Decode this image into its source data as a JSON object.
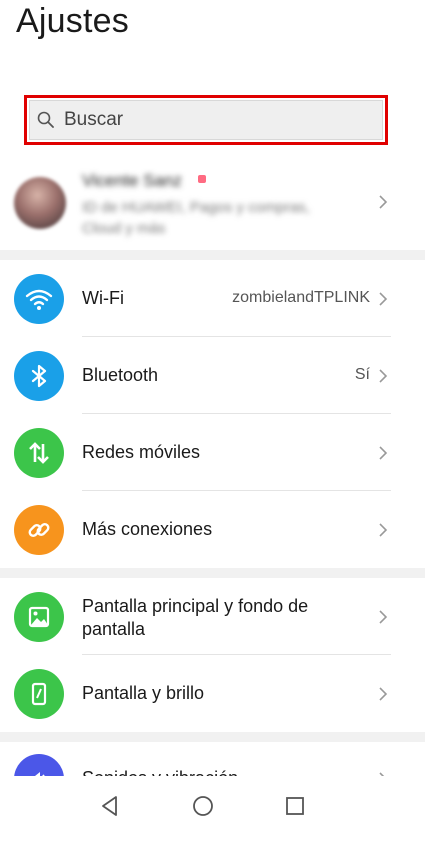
{
  "header": {
    "title": "Ajustes"
  },
  "search": {
    "placeholder": "Buscar"
  },
  "account": {
    "name": "Vicente Sanz",
    "subtitle": "ID de HUAWEI, Pagos y compras, Cloud y más"
  },
  "sections": [
    {
      "items": [
        {
          "label": "Wi-Fi",
          "value": "zombielandTPLINK",
          "icon": "wifi-icon",
          "color": "#1aa0e8"
        },
        {
          "label": "Bluetooth",
          "value": "Sí",
          "icon": "bluetooth-icon",
          "color": "#1aa0e8"
        },
        {
          "label": "Redes móviles",
          "value": "",
          "icon": "mobile-data-icon",
          "color": "#3cc54a"
        },
        {
          "label": "Más conexiones",
          "value": "",
          "icon": "link-icon",
          "color": "#f7941d"
        }
      ]
    },
    {
      "items": [
        {
          "label": "Pantalla principal y fondo de pantalla",
          "icon": "wallpaper-icon",
          "color": "#3cc54a"
        },
        {
          "label": "Pantalla y brillo",
          "icon": "display-brightness-icon",
          "color": "#3cc54a"
        }
      ]
    },
    {
      "items": [
        {
          "label": "Sonidos y vibración",
          "icon": "sound-icon",
          "color": "#4b57e8"
        }
      ]
    }
  ],
  "navbar": {
    "icons": [
      "back-icon",
      "home-icon",
      "recents-icon"
    ]
  }
}
